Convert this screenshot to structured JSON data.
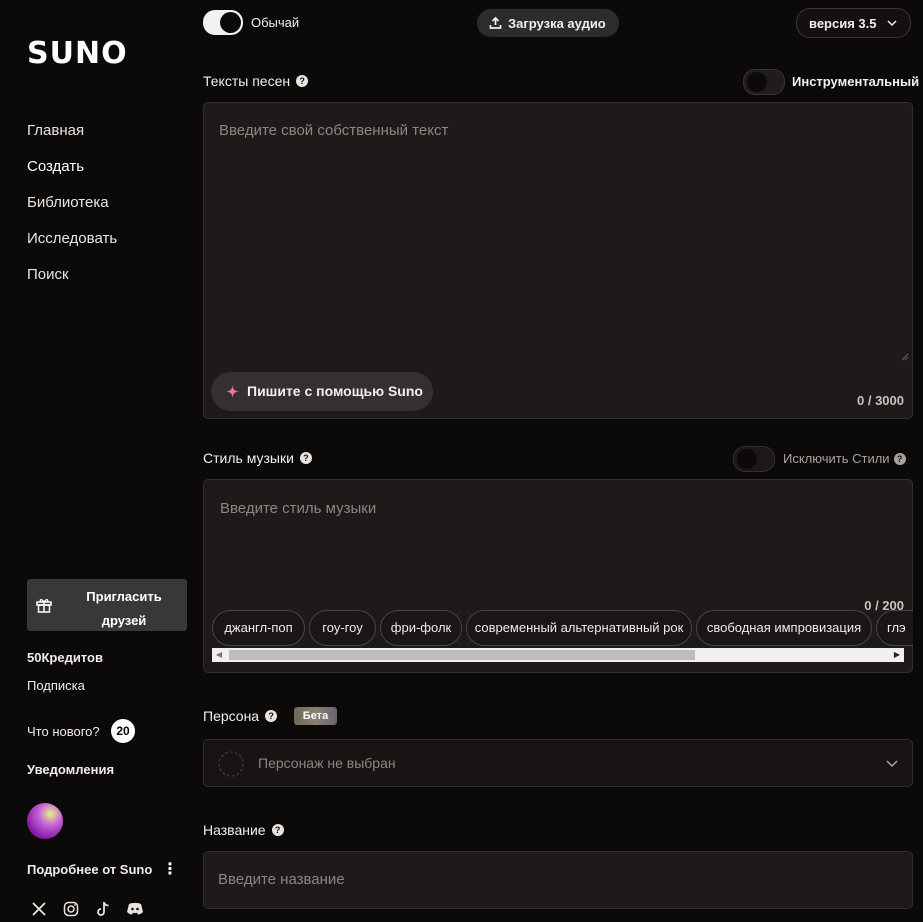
{
  "brand": {
    "logo": "SUNO"
  },
  "sidebar": {
    "nav": [
      {
        "label": "Главная"
      },
      {
        "label": "Создать"
      },
      {
        "label": "Библиотека"
      },
      {
        "label": "Исследовать"
      },
      {
        "label": "Поиск"
      }
    ],
    "invite_label": "Пригласить друзей",
    "credits": "50Кредитов",
    "subscription": "Подписка",
    "whats_new": "Что нового?",
    "whats_new_count": "20",
    "notifications": "Уведомления",
    "more_from": "Подробнее от Suno",
    "socials": [
      "x-icon",
      "instagram-icon",
      "tiktok-icon",
      "discord-icon"
    ]
  },
  "header": {
    "mode_label": "Обычай",
    "mode_on": true,
    "upload_label": "Загрузка аудио",
    "version_label": "версия 3.5"
  },
  "lyrics": {
    "label": "Тексты песен",
    "instrumental_label": "Инструментальный",
    "instrumental_on": false,
    "placeholder": "Введите свой собственный текст",
    "assist_label": "Пишите с помощью Suno",
    "counter": "0 / 3000"
  },
  "style": {
    "label": "Стиль музыки",
    "exclude_label": "Исключить Стили",
    "exclude_on": false,
    "placeholder": "Введите стиль музыки",
    "counter": "0 / 200",
    "tags": [
      "джангл-поп",
      "гоу-гоу",
      "фри-фолк",
      "современный альтернативный рок",
      "свободная импровизация",
      "глэ"
    ]
  },
  "persona": {
    "label": "Персона",
    "badge": "Бета",
    "selected": "Персонаж не выбран"
  },
  "title": {
    "label": "Название",
    "placeholder": "Введите название"
  },
  "colors": {
    "background": "#0c0909",
    "panel": "#1e1a1a",
    "accent_star": "#f46ea0"
  }
}
